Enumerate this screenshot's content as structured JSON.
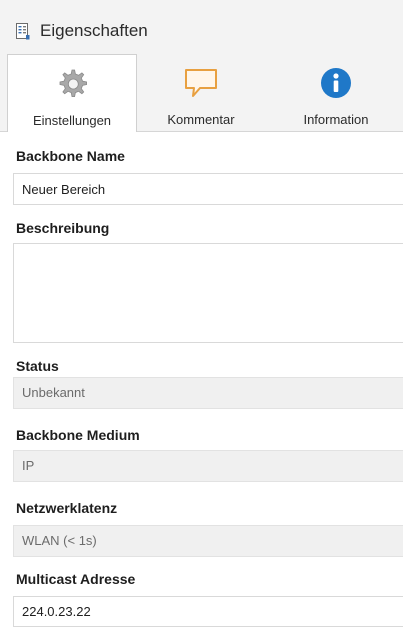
{
  "header": {
    "title": "Eigenschaften",
    "icon": "properties-sheet-icon"
  },
  "tabs": [
    {
      "label": "Einstellungen",
      "icon": "gear-icon",
      "active": true
    },
    {
      "label": "Kommentar",
      "icon": "comment-icon",
      "active": false
    },
    {
      "label": "Information",
      "icon": "info-icon",
      "active": false
    }
  ],
  "fields": {
    "backbone_name": {
      "label": "Backbone Name",
      "value": "Neuer Bereich"
    },
    "beschreibung": {
      "label": "Beschreibung",
      "value": ""
    },
    "status": {
      "label": "Status",
      "value": "Unbekannt"
    },
    "backbone_medium": {
      "label": "Backbone Medium",
      "value": "IP"
    },
    "netzwerklatenz": {
      "label": "Netzwerklatenz",
      "value": "WLAN (< 1s)"
    },
    "multicast_adresse": {
      "label": "Multicast Adresse",
      "value": "224.0.23.22"
    }
  },
  "colors": {
    "accent_info": "#1f78c8",
    "comment_orange": "#e8a040",
    "gear_gray": "#9a9a9a"
  }
}
